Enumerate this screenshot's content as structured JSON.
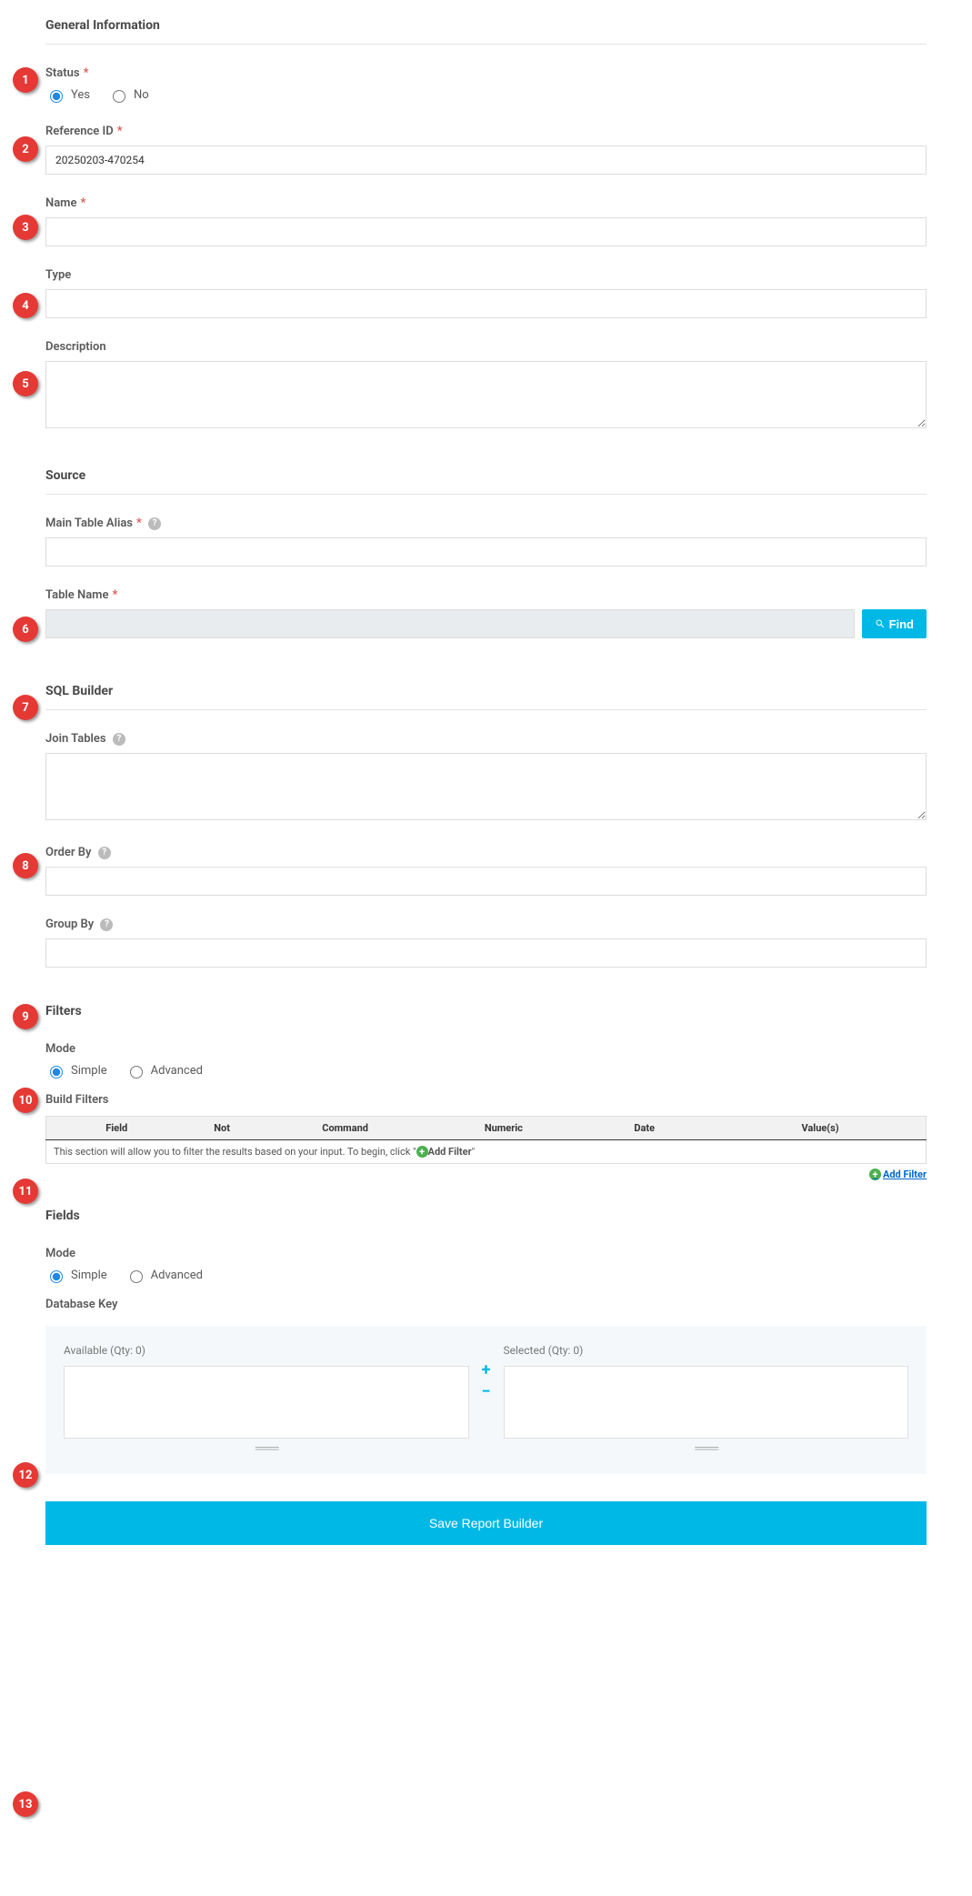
{
  "markers": [
    "1",
    "2",
    "3",
    "4",
    "5",
    "6",
    "7",
    "8",
    "9",
    "10",
    "11",
    "12",
    "13"
  ],
  "general": {
    "title": "General Information",
    "status_label": "Status",
    "status_yes": "Yes",
    "status_no": "No",
    "refid_label": "Reference ID",
    "refid_value": "20250203-470254",
    "name_label": "Name",
    "type_label": "Type",
    "desc_label": "Description"
  },
  "source": {
    "title": "Source",
    "alias_label": "Main Table Alias",
    "table_label": "Table Name",
    "find_label": "Find"
  },
  "sql": {
    "title": "SQL Builder",
    "join_label": "Join Tables",
    "orderby_label": "Order By",
    "groupby_label": "Group By"
  },
  "filters": {
    "title": "Filters",
    "mode_label": "Mode",
    "mode_simple": "Simple",
    "mode_advanced": "Advanced",
    "build_label": "Build Filters",
    "cols": {
      "field": "Field",
      "not": "Not",
      "command": "Command",
      "numeric": "Numeric",
      "date": "Date",
      "values": "Value(s)"
    },
    "empty_prefix": "This section will allow you to filter the results based on your input. To begin, click \"",
    "empty_link": "Add Filter",
    "empty_suffix": "\"",
    "add_link": "Add Filter"
  },
  "fields": {
    "title": "Fields",
    "mode_label": "Mode",
    "mode_simple": "Simple",
    "mode_advanced": "Advanced",
    "dbkey_label": "Database Key",
    "available_label": "Available  (Qty: 0)",
    "selected_label": "Selected  (Qty: 0)"
  },
  "save_label": "Save Report Builder"
}
